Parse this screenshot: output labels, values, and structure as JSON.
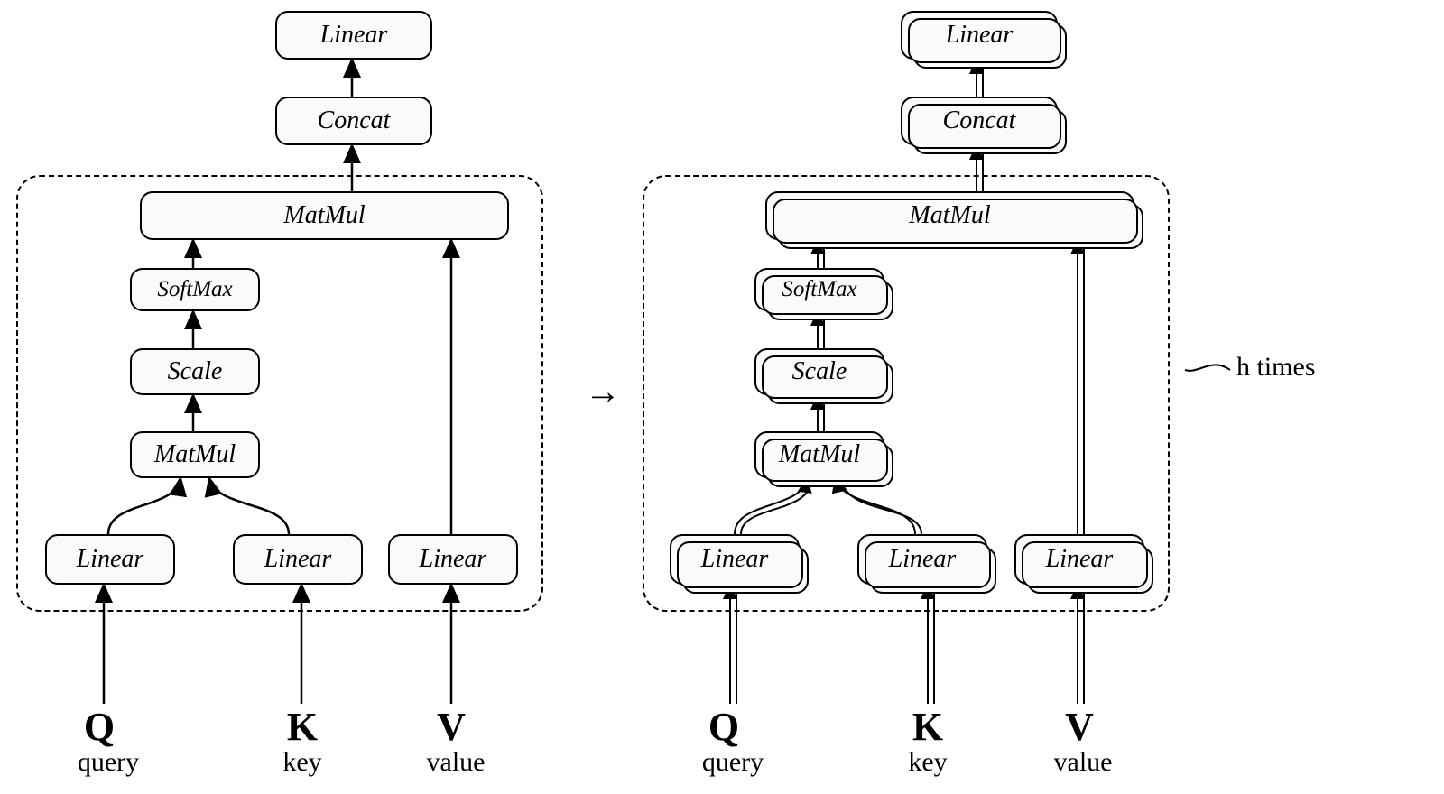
{
  "left": {
    "linear_top": "Linear",
    "concat": "Concat",
    "matmul_top": "MatMul",
    "softmax": "SoftMax",
    "scale": "Scale",
    "matmul_bottom": "MatMul",
    "linear_q": "Linear",
    "linear_k": "Linear",
    "linear_v": "Linear",
    "Q": "Q",
    "K": "K",
    "V": "V",
    "q_label": "query",
    "k_label": "key",
    "v_label": "value"
  },
  "right": {
    "linear_top": "Linear",
    "concat": "Concat",
    "matmul_top": "MatMul",
    "softmax": "SoftMax",
    "scale": "Scale",
    "matmul_bottom": "MatMul",
    "linear_q": "Linear",
    "linear_k": "Linear",
    "linear_v": "Linear",
    "Q": "Q",
    "K": "K",
    "V": "V",
    "q_label": "query",
    "k_label": "key",
    "v_label": "value",
    "annotation": "h times"
  },
  "transition_arrow": "→"
}
